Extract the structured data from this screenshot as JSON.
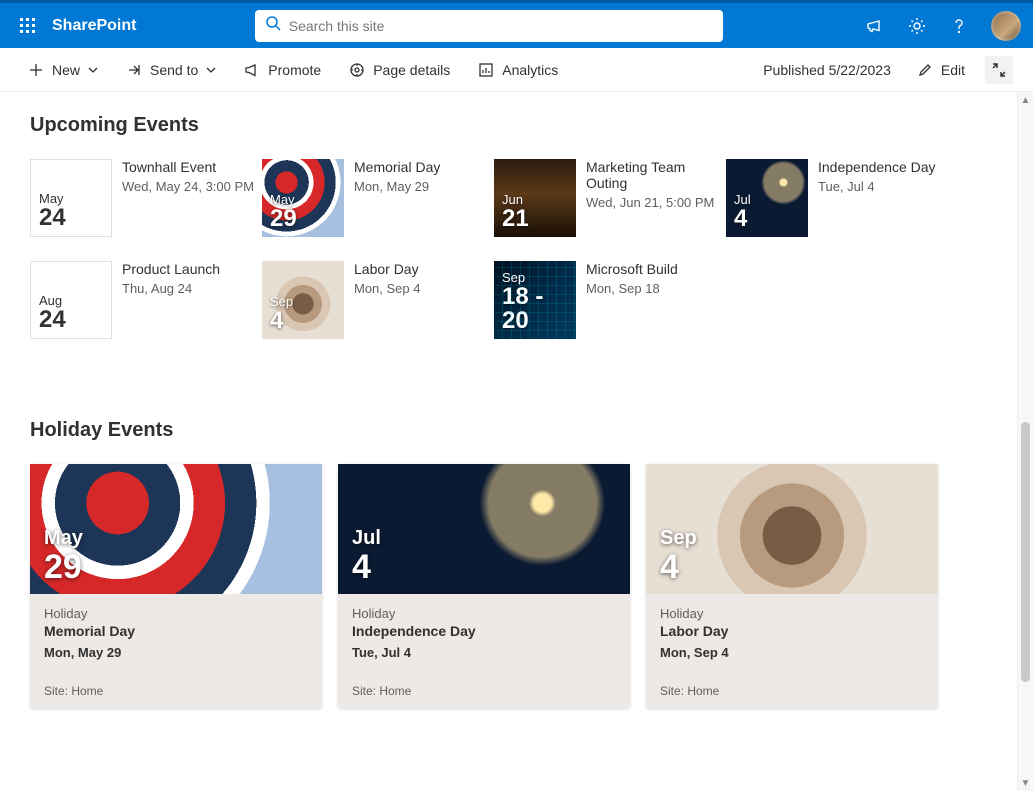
{
  "app": {
    "brand": "SharePoint"
  },
  "search": {
    "placeholder": "Search this site"
  },
  "commands": {
    "new": "New",
    "send_to": "Send to",
    "promote": "Promote",
    "page_details": "Page details",
    "analytics": "Analytics",
    "published": "Published 5/22/2023",
    "edit": "Edit"
  },
  "sections": {
    "upcoming": "Upcoming Events",
    "holiday": "Holiday Events"
  },
  "events": [
    {
      "title": "Townhall Event",
      "date": "Wed, May 24, 3:00 PM",
      "month": "May",
      "day": "24",
      "img": ""
    },
    {
      "title": "Memorial Day",
      "date": "Mon, May 29",
      "month": "May",
      "day": "29",
      "img": "bg-pinwheel"
    },
    {
      "title": "Marketing Team Outing",
      "date": "Wed, Jun 21, 5:00 PM",
      "month": "Jun",
      "day": "21",
      "img": "bg-dinner"
    },
    {
      "title": "Independence Day",
      "date": "Tue, Jul 4",
      "month": "Jul",
      "day": "4",
      "img": "bg-fireworks"
    },
    {
      "title": "Product Launch",
      "date": "Thu, Aug 24",
      "month": "Aug",
      "day": "24",
      "img": ""
    },
    {
      "title": "Labor Day",
      "date": "Mon, Sep 4",
      "month": "Sep",
      "day": "4",
      "img": "bg-hands"
    },
    {
      "title": "Microsoft Build",
      "date": "Mon, Sep 18",
      "month": "Sep",
      "day": "18 - 20",
      "img": "bg-build"
    }
  ],
  "holiday_cards": [
    {
      "category": "Holiday",
      "title": "Memorial Day",
      "date": "Mon, May 29",
      "month": "May",
      "day": "29",
      "img": "bg-pinwheel",
      "site": "Site: Home"
    },
    {
      "category": "Holiday",
      "title": "Independence Day",
      "date": "Tue, Jul 4",
      "month": "Jul",
      "day": "4",
      "img": "bg-fireworks",
      "site": "Site: Home"
    },
    {
      "category": "Holiday",
      "title": "Labor Day",
      "date": "Mon, Sep 4",
      "month": "Sep",
      "day": "4",
      "img": "bg-hands",
      "site": "Site: Home"
    }
  ]
}
